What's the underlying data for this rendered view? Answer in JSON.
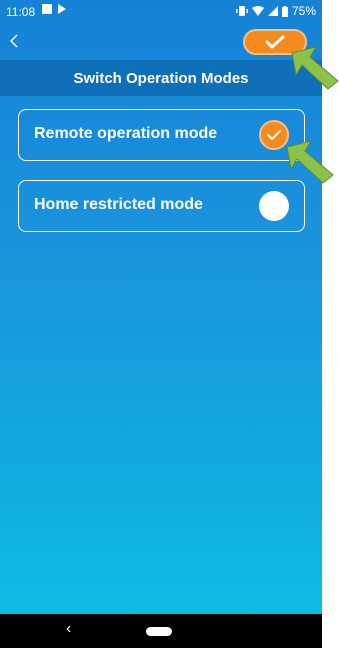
{
  "status_bar": {
    "time": "11:08",
    "battery": "75%"
  },
  "header": {
    "back_icon": "chevron-left-icon",
    "confirm_icon": "checkmark-icon",
    "title": "Switch Operation Modes"
  },
  "modes": [
    {
      "label": "Remote operation mode",
      "selected": true
    },
    {
      "label": "Home restricted mode",
      "selected": false
    }
  ],
  "colors": {
    "accent": "#f58a1f",
    "title_bar": "#0f6fb8",
    "background_top": "#1682d6",
    "background_bottom": "#0cc2e4",
    "pointer": "#8bc34a"
  }
}
